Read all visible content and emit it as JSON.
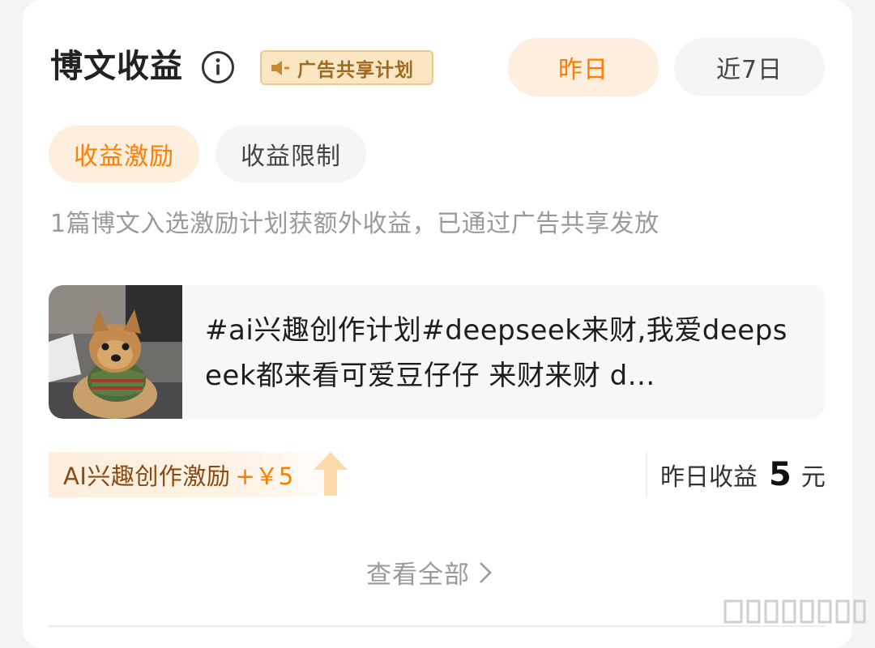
{
  "header": {
    "title": "博文收益",
    "info_icon": "info-circle-icon",
    "ad_badge": {
      "icon": "speaker-icon",
      "label": "广告共享计划"
    },
    "range_tabs": [
      {
        "label": "昨日",
        "active": true
      },
      {
        "label": "近7日",
        "active": false
      }
    ]
  },
  "sub_tabs": [
    {
      "label": "收益激励",
      "active": true
    },
    {
      "label": "收益限制",
      "active": false
    }
  ],
  "description": "1篇博文入选激励计划获额外收益，已通过广告共享发放",
  "post": {
    "thumbnail": "dog-photo",
    "text": "#ai兴趣创作计划#deepseek来财,我爱deepseek都来看可爱豆仔仔 来财来财 d..."
  },
  "reward": {
    "label": "AI兴趣创作激励",
    "amount": "+￥5",
    "icon": "up-arrow-icon"
  },
  "earnings": {
    "label": "昨日收益",
    "value": "5",
    "unit": "元"
  },
  "view_all": {
    "label": "查看全部",
    "icon": "chevron-right-icon"
  },
  "colors": {
    "accent": "#ff7d00",
    "accent_bg": "#fdeedd",
    "badge_text": "#a06a23",
    "badge_bg": "#fbe6c4"
  }
}
